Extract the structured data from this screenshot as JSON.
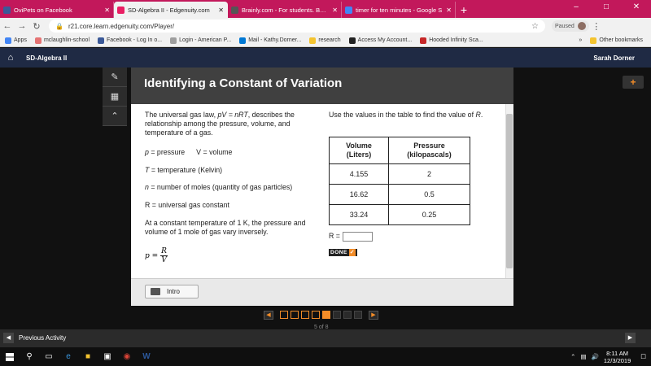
{
  "browser": {
    "tabs": [
      {
        "title": "OviPets on Facebook",
        "color": "#3b5998",
        "active": false
      },
      {
        "title": "SD-Algebra II - Edgenuity.com",
        "color": "#e91e63",
        "active": true
      },
      {
        "title": "Brainly.com - For students. By st",
        "color": "#555555",
        "active": false
      },
      {
        "title": "timer for ten minutes - Google S",
        "color": "#4285f4",
        "active": false
      }
    ],
    "url": "r21.core.learn.edgenuity.com/Player/",
    "paused_label": "Paused",
    "bookmarks": [
      {
        "label": "Apps",
        "color": "#4285f4"
      },
      {
        "label": "mclaughlin-school",
        "color": "#e57373"
      },
      {
        "label": "Facebook - Log In o...",
        "color": "#3b5998"
      },
      {
        "label": "Login - American P...",
        "color": "#9e9e9e"
      },
      {
        "label": "Mail - Kathy.Dorner...",
        "color": "#0078d4"
      },
      {
        "label": "research",
        "color": "#f4c430"
      },
      {
        "label": "Access My Account...",
        "color": "#222222"
      },
      {
        "label": "Hooded Infinity Sca...",
        "color": "#c62828"
      }
    ],
    "more_bookmarks": "»",
    "other_bookmarks": "Other bookmarks"
  },
  "app": {
    "course": "SD-Algebra II",
    "user": "Sarah Dorner"
  },
  "lesson": {
    "title": "Identifying a Constant of Variation",
    "intro_1": "The universal gas law, ",
    "intro_eq": "pV = nRT",
    "intro_2": ", describes the relationship among the pressure, volume, and temperature of a gas.",
    "p_sym": "p",
    "p_def": " = pressure",
    "v_sym": "V",
    "v_def": " = volume",
    "t_sym": "T",
    "t_def": " = temperature (Kelvin)",
    "n_sym": "n",
    "n_def": " = number of moles (quantity of gas particles)",
    "r_sym": "R",
    "r_def": " = universal gas constant",
    "constant_text": "At a constant temperature of 1 K, the pressure and volume of 1 mole of gas vary inversely.",
    "formula": {
      "lhs": "p =",
      "num": "R",
      "den": "V"
    },
    "instruction_1": "Use the values in the table to find the value of ",
    "instruction_var": "R",
    "instruction_2": ".",
    "table": {
      "headers": [
        "Volume\n(Liters)",
        "Pressure\n(kilopascals)"
      ],
      "rows": [
        [
          "4.155",
          "2"
        ],
        [
          "16.62",
          "0.5"
        ],
        [
          "33.24",
          "0.25"
        ]
      ]
    },
    "answer_label": "R =",
    "answer_value": "",
    "done_label": "DONE",
    "intro_button": "Intro"
  },
  "pager": {
    "total": 8,
    "current": 5,
    "count_text": "5 of 8"
  },
  "activity": {
    "prev_label": "Previous Activity"
  },
  "taskbar": {
    "time": "8:11 AM",
    "date": "12/3/2019"
  }
}
